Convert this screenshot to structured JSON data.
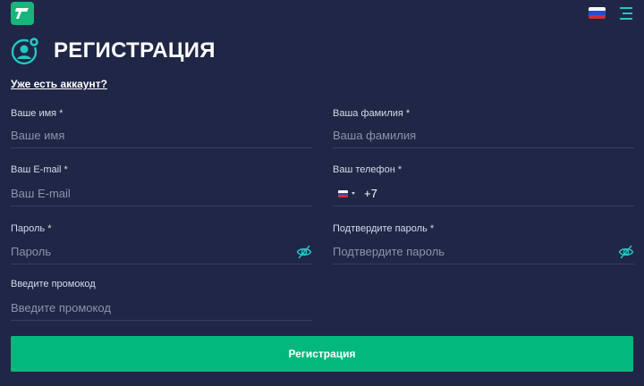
{
  "header": {
    "logo_icon": "brand-logo-icon",
    "language_flag_icon": "russia-flag-icon",
    "menu_icon": "hamburger-menu-icon"
  },
  "page": {
    "title": "РЕГИСТРАЦИЯ",
    "title_icon": "user-add-icon",
    "login_link": "Уже есть аккаунт?"
  },
  "form": {
    "first_name": {
      "label": "Ваше имя *",
      "placeholder": "Ваше имя",
      "value": ""
    },
    "last_name": {
      "label": "Ваша фамилия *",
      "placeholder": "Ваша фамилия",
      "value": ""
    },
    "email": {
      "label": "Ваш E-mail *",
      "placeholder": "Ваш E-mail",
      "value": ""
    },
    "phone": {
      "label": "Ваш телефон *",
      "country_icon": "russia-flag-icon",
      "dial_code": "+7",
      "value": ""
    },
    "password": {
      "label": "Пароль *",
      "placeholder": "Пароль",
      "value": "",
      "toggle_icon": "eye-off-icon"
    },
    "confirm_password": {
      "label": "Подтвердите пароль *",
      "placeholder": "Подтвердите пароль",
      "value": "",
      "toggle_icon": "eye-off-icon"
    },
    "promo": {
      "label": "Введите промокод",
      "placeholder": "Введите промокод",
      "value": ""
    },
    "submit_label": "Регистрация"
  },
  "colors": {
    "background": "#1f2646",
    "accent": "#03b87c",
    "icon_accent": "#23c7c2",
    "placeholder": "#8c93ad",
    "divider": "#39415f"
  }
}
